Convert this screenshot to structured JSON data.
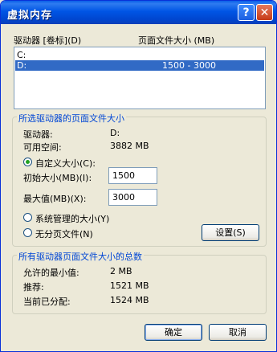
{
  "window": {
    "title": "虚拟内存",
    "help_glyph": "?",
    "close_glyph": "✕"
  },
  "drives": {
    "col_drive": "驱动器 [卷标](D)",
    "col_size": "页面文件大小 (MB)",
    "rows": [
      {
        "drive": "C:",
        "size": ""
      },
      {
        "drive": "D:",
        "size": "1500 - 3000"
      }
    ]
  },
  "selected": {
    "group_title": "所选驱动器的页面文件大小",
    "drive_label": "驱动器:",
    "drive_value": "D:",
    "free_label": "可用空间:",
    "free_value": "3882 MB",
    "custom_label": "自定义大小(C):",
    "initial_label": "初始大小(MB)(I):",
    "initial_value": "1500",
    "max_label": "最大值(MB)(X):",
    "max_value": "3000",
    "system_label": "系统管理的大小(Y)",
    "none_label": "无分页文件(N)",
    "set_button": "设置(S)"
  },
  "total": {
    "group_title": "所有驱动器页面文件大小的总数",
    "min_label": "允许的最小值:",
    "min_value": "2 MB",
    "rec_label": "推荐:",
    "rec_value": "1521 MB",
    "cur_label": "当前已分配:",
    "cur_value": "1524 MB"
  },
  "buttons": {
    "ok": "确定",
    "cancel": "取消"
  }
}
